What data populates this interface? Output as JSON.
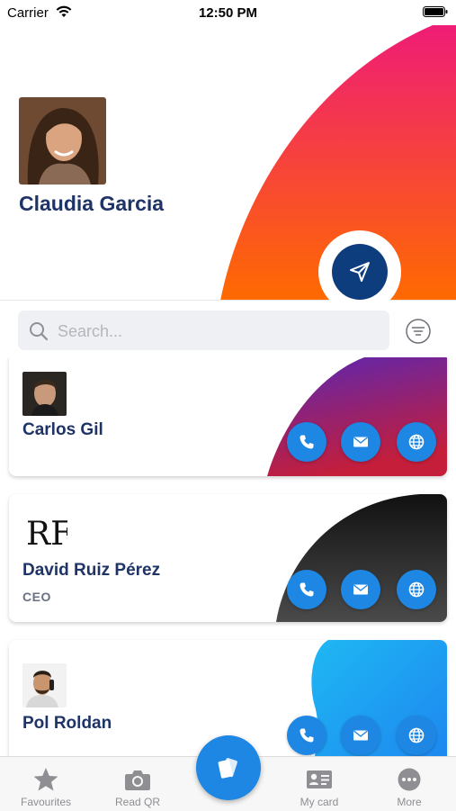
{
  "status_bar": {
    "carrier": "Carrier",
    "time": "12:50 PM"
  },
  "profile": {
    "name": "Claudia Garcia",
    "share_icon": "send-icon"
  },
  "search": {
    "placeholder": "Search...",
    "value": ""
  },
  "contacts": [
    {
      "name": "Carlos Gil",
      "role": "",
      "theme": "purple-red-gradient"
    },
    {
      "name": "David Ruiz Pérez",
      "role": "CEO",
      "logo_text": "RF",
      "theme": "black-gradient"
    },
    {
      "name": "Pol Roldan",
      "role": "",
      "theme": "blue-gradient"
    }
  ],
  "card_actions": [
    "phone-icon",
    "mail-icon",
    "globe-icon"
  ],
  "tabbar": {
    "items": [
      {
        "label": "Favourites",
        "icon": "star-icon"
      },
      {
        "label": "Read QR",
        "icon": "camera-icon"
      },
      {
        "label": "My card",
        "icon": "id-card-icon"
      },
      {
        "label": "More",
        "icon": "more-icon"
      }
    ],
    "center_icon": "cards-icon"
  },
  "colors": {
    "accent": "#1e86e3",
    "name": "#1e3366",
    "share_button": "#0e3d7e",
    "hero_gradient": [
      "#ee1a7a",
      "#ff6a00"
    ]
  }
}
